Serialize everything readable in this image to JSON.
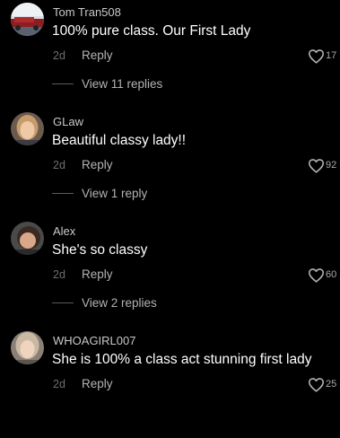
{
  "comments": [
    {
      "username": "Tom Tran508",
      "text": "100% pure class. Our First Lady",
      "age": "2d",
      "reply_label": "Reply",
      "likes": "17",
      "view_replies": "View 11 replies",
      "avatar_icon": "car-photo-avatar"
    },
    {
      "username": "GLaw",
      "text": "Beautiful classy lady!!",
      "age": "2d",
      "reply_label": "Reply",
      "likes": "92",
      "view_replies": "View 1 reply",
      "avatar_icon": "selfie-avatar"
    },
    {
      "username": "Alex",
      "text": "She's so classy",
      "age": "2d",
      "reply_label": "Reply",
      "likes": "60",
      "view_replies": "View 2 replies",
      "avatar_icon": "selfie-avatar"
    },
    {
      "username": "WHOAGIRL007",
      "text": "She is 100% a class act stunning first lady",
      "age": "2d",
      "reply_label": "Reply",
      "likes": "25",
      "avatar_icon": "selfie-avatar"
    }
  ],
  "colors": {
    "background": "#000000",
    "username": "#c9c9c9",
    "secondary": "#b3b3b3",
    "timestamp": "#6f6f6f"
  }
}
